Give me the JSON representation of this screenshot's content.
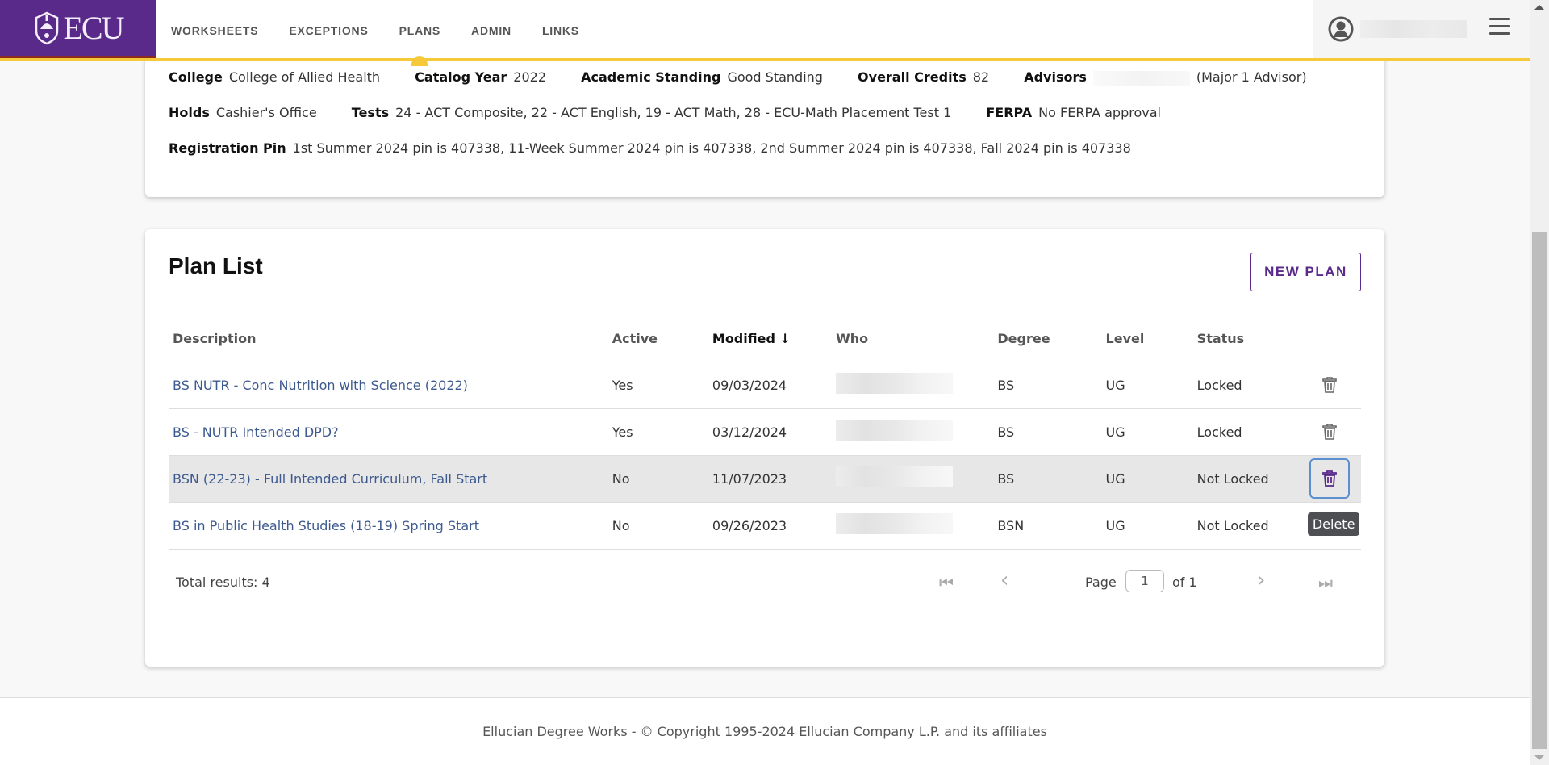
{
  "header": {
    "logo_text": "ECU",
    "nav": [
      {
        "label": "WORKSHEETS",
        "active": false
      },
      {
        "label": "EXCEPTIONS",
        "active": false
      },
      {
        "label": "PLANS",
        "active": true
      },
      {
        "label": "ADMIN",
        "active": false
      },
      {
        "label": "LINKS",
        "active": false
      }
    ],
    "user_icon": "user-circle-icon",
    "menu_icon": "hamburger-menu-icon"
  },
  "student_info": {
    "college_label": "College",
    "college": "College of Allied Health",
    "catalog_year_label": "Catalog Year",
    "catalog_year": "2022",
    "standing_label": "Academic Standing",
    "standing": "Good Standing",
    "credits_label": "Overall Credits",
    "credits": "82",
    "advisors_label": "Advisors",
    "advisor_role": "(Major 1 Advisor)",
    "holds_label": "Holds",
    "holds": "Cashier's Office",
    "tests_label": "Tests",
    "tests": "24 - ACT Composite, 22 - ACT English, 19 - ACT Math, 28 - ECU-Math Placement Test 1",
    "ferpa_label": "FERPA",
    "ferpa": "No FERPA approval",
    "pin_label": "Registration Pin",
    "pin": "1st Summer 2024 pin is 407338, 11-Week Summer 2024 pin is 407338, 2nd Summer 2024 pin is 407338, Fall 2024 pin is 407338"
  },
  "plan_list": {
    "title": "Plan List",
    "new_plan_label": "NEW PLAN",
    "columns": {
      "description": "Description",
      "active": "Active",
      "modified": "Modified",
      "modified_sort": "↓",
      "who": "Who",
      "degree": "Degree",
      "level": "Level",
      "status": "Status"
    },
    "rows": [
      {
        "description": "BS NUTR - Conc Nutrition with Science (2022)",
        "active": "Yes",
        "modified": "09/03/2024",
        "degree": "BS",
        "level": "UG",
        "status": "Locked"
      },
      {
        "description": "BS - NUTR Intended DPD?",
        "active": "Yes",
        "modified": "03/12/2024",
        "degree": "BS",
        "level": "UG",
        "status": "Locked"
      },
      {
        "description": "BSN (22-23) - Full Intended Curriculum, Fall Start",
        "active": "No",
        "modified": "11/07/2023",
        "degree": "BS",
        "level": "UG",
        "status": "Not Locked"
      },
      {
        "description": "BS in Public Health Studies (18-19) Spring Start",
        "active": "No",
        "modified": "09/26/2023",
        "degree": "BSN",
        "level": "UG",
        "status": "Not Locked"
      }
    ],
    "tooltip": "Delete",
    "pagination": {
      "total_label": "Total results: 4",
      "page_label": "Page",
      "page_value": "1",
      "of_label": "of 1",
      "first_icon": "⏮",
      "prev_icon": "‹",
      "next_icon": "›",
      "last_icon": "⏭"
    }
  },
  "footer": {
    "text": "Ellucian Degree Works - © Copyright 1995-2024 Ellucian Company L.P. and its affiliates"
  },
  "colors": {
    "brand_purple": "#592a8a",
    "brand_gold": "#f5c93a",
    "link": "#3d5a8f"
  }
}
